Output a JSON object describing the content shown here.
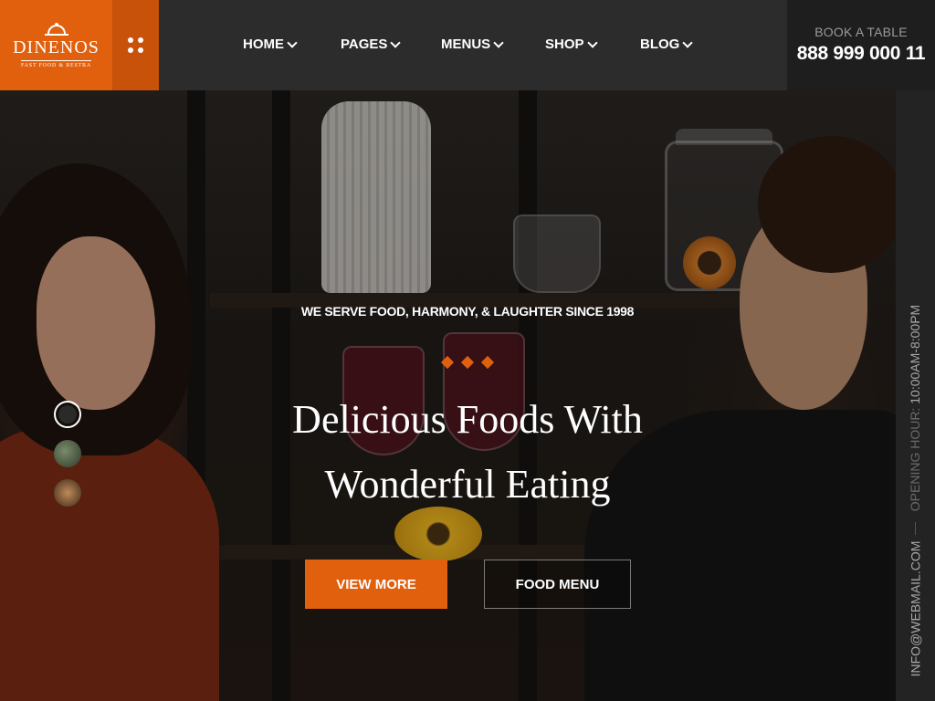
{
  "brand": {
    "name": "DINENOS",
    "tagline": "FAST FOOD & RESTRA",
    "logo_icon": "cloche-icon"
  },
  "header": {
    "menu_icon": "grid-dots-icon",
    "nav": [
      {
        "label": "HOME"
      },
      {
        "label": "PAGES"
      },
      {
        "label": "MENUS"
      },
      {
        "label": "SHOP"
      },
      {
        "label": "BLOG"
      }
    ],
    "book": {
      "label": "BOOK A TABLE",
      "phone": "888 999 000 11"
    }
  },
  "hero": {
    "tagline": "WE SERVE FOOD, HARMONY, & LAUGHTER SINCE 1998",
    "title_line1": "Delicious Foods With",
    "title_line2": "Wonderful Eating",
    "primary_button": "VIEW MORE",
    "secondary_button": "FOOD MENU",
    "slides": 3,
    "active_slide": 1
  },
  "sidebar": {
    "hours_label": "OPENING HOUR:",
    "hours_value": "10:00AM-8:00PM",
    "email": "INFO@WEBMAIL.COM"
  },
  "colors": {
    "accent": "#e0600d",
    "accent_dark": "#c85209",
    "header_bg": "#2c2c2c",
    "book_bg": "#1e1e1e",
    "sidebar_bg": "#232323"
  }
}
